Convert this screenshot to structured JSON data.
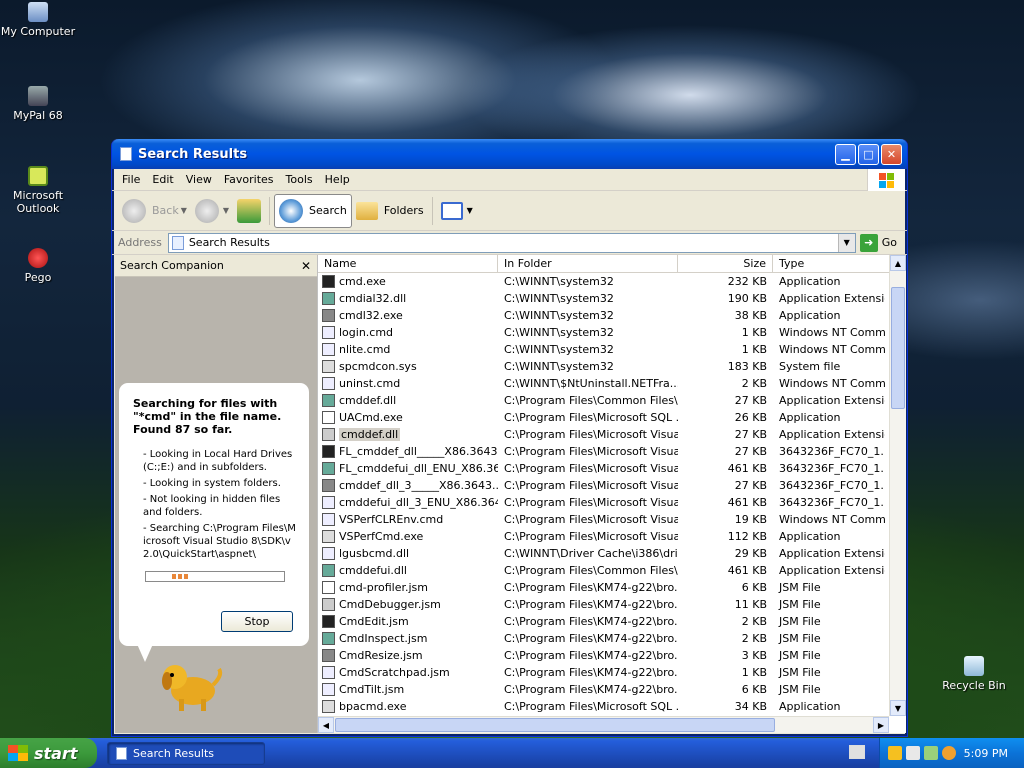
{
  "desktop": {
    "icons": [
      {
        "label": "My Computer"
      },
      {
        "label": "MyPal 68"
      },
      {
        "label": "Microsoft Outlook"
      },
      {
        "label": "Pego"
      },
      {
        "label": "Recycle Bin"
      }
    ]
  },
  "window": {
    "title": "Search Results",
    "menu": [
      "File",
      "Edit",
      "View",
      "Favorites",
      "Tools",
      "Help"
    ],
    "toolbar": {
      "back": "Back",
      "search": "Search",
      "folders": "Folders"
    },
    "address": {
      "label": "Address",
      "value": "Search Results",
      "go": "Go"
    }
  },
  "companion": {
    "title": "Search Companion",
    "close": "✕",
    "status_title": "Searching for files with \"*cmd\" in the file name. Found 87 so far.",
    "lines": [
      "- Looking in Local Hard Drives (C:;E:) and in subfolders.",
      "- Looking in system folders.",
      "- Not looking in hidden files and folders.",
      "- Searching C:\\Program Files\\Microsoft Visual Studio 8\\SDK\\v2.0\\QuickStart\\aspnet\\"
    ],
    "progress": 0.15,
    "stop": "Stop"
  },
  "results": {
    "columns": [
      "Name",
      "In Folder",
      "Size",
      "Type"
    ],
    "rows": [
      [
        "cmd.exe",
        "C:\\WINNT\\system32",
        "232 KB",
        "Application"
      ],
      [
        "cmdial32.dll",
        "C:\\WINNT\\system32",
        "190 KB",
        "Application Extension"
      ],
      [
        "cmdl32.exe",
        "C:\\WINNT\\system32",
        "38 KB",
        "Application"
      ],
      [
        "login.cmd",
        "C:\\WINNT\\system32",
        "1 KB",
        "Windows NT Comm..."
      ],
      [
        "nlite.cmd",
        "C:\\WINNT\\system32",
        "1 KB",
        "Windows NT Comm..."
      ],
      [
        "spcmdcon.sys",
        "C:\\WINNT\\system32",
        "183 KB",
        "System file"
      ],
      [
        "uninst.cmd",
        "C:\\WINNT\\$NtUninstall.NETFra...",
        "2 KB",
        "Windows NT Comm..."
      ],
      [
        "cmddef.dll",
        "C:\\Program Files\\Common Files\\...",
        "27 KB",
        "Application Extension"
      ],
      [
        "UACmd.exe",
        "C:\\Program Files\\Microsoft SQL ...",
        "26 KB",
        "Application"
      ],
      [
        "cmddef.dll",
        "C:\\Program Files\\Microsoft Visua...",
        "27 KB",
        "Application Extension"
      ],
      [
        "FL_cmddef_dll_____X86.3643...",
        "C:\\Program Files\\Microsoft Visua...",
        "27 KB",
        "3643236F_FC70_1..."
      ],
      [
        "FL_cmddefui_dll_ENU_X86.36...",
        "C:\\Program Files\\Microsoft Visua...",
        "461 KB",
        "3643236F_FC70_1..."
      ],
      [
        "cmddef_dll_3_____X86.3643...",
        "C:\\Program Files\\Microsoft Visua...",
        "27 KB",
        "3643236F_FC70_1..."
      ],
      [
        "cmddefui_dll_3_ENU_X86.364...",
        "C:\\Program Files\\Microsoft Visua...",
        "461 KB",
        "3643236F_FC70_1..."
      ],
      [
        "VSPerfCLREnv.cmd",
        "C:\\Program Files\\Microsoft Visua...",
        "19 KB",
        "Windows NT Comm..."
      ],
      [
        "VSPerfCmd.exe",
        "C:\\Program Files\\Microsoft Visua...",
        "112 KB",
        "Application"
      ],
      [
        "lgusbcmd.dll",
        "C:\\WINNT\\Driver Cache\\i386\\dri...",
        "29 KB",
        "Application Extension"
      ],
      [
        "cmddefui.dll",
        "C:\\Program Files\\Common Files\\...",
        "461 KB",
        "Application Extension"
      ],
      [
        "cmd-profiler.jsm",
        "C:\\Program Files\\KM74-g22\\bro...",
        "6 KB",
        "JSM File"
      ],
      [
        "CmdDebugger.jsm",
        "C:\\Program Files\\KM74-g22\\bro...",
        "11 KB",
        "JSM File"
      ],
      [
        "CmdEdit.jsm",
        "C:\\Program Files\\KM74-g22\\bro...",
        "2 KB",
        "JSM File"
      ],
      [
        "CmdInspect.jsm",
        "C:\\Program Files\\KM74-g22\\bro...",
        "2 KB",
        "JSM File"
      ],
      [
        "CmdResize.jsm",
        "C:\\Program Files\\KM74-g22\\bro...",
        "3 KB",
        "JSM File"
      ],
      [
        "CmdScratchpad.jsm",
        "C:\\Program Files\\KM74-g22\\bro...",
        "1 KB",
        "JSM File"
      ],
      [
        "CmdTilt.jsm",
        "C:\\Program Files\\KM74-g22\\bro...",
        "6 KB",
        "JSM File"
      ],
      [
        "bpacmd.exe",
        "C:\\Program Files\\Microsoft SQL ...",
        "34 KB",
        "Application"
      ]
    ],
    "selected_index": 9
  },
  "taskbar": {
    "start": "start",
    "task": "Search Results",
    "clock": "5:09 PM"
  },
  "colors": {
    "title_blue": "#0054e3",
    "start_green": "#3c9a3c",
    "taskbar_blue": "#245edb",
    "tray_blue": "#0b73d8"
  }
}
